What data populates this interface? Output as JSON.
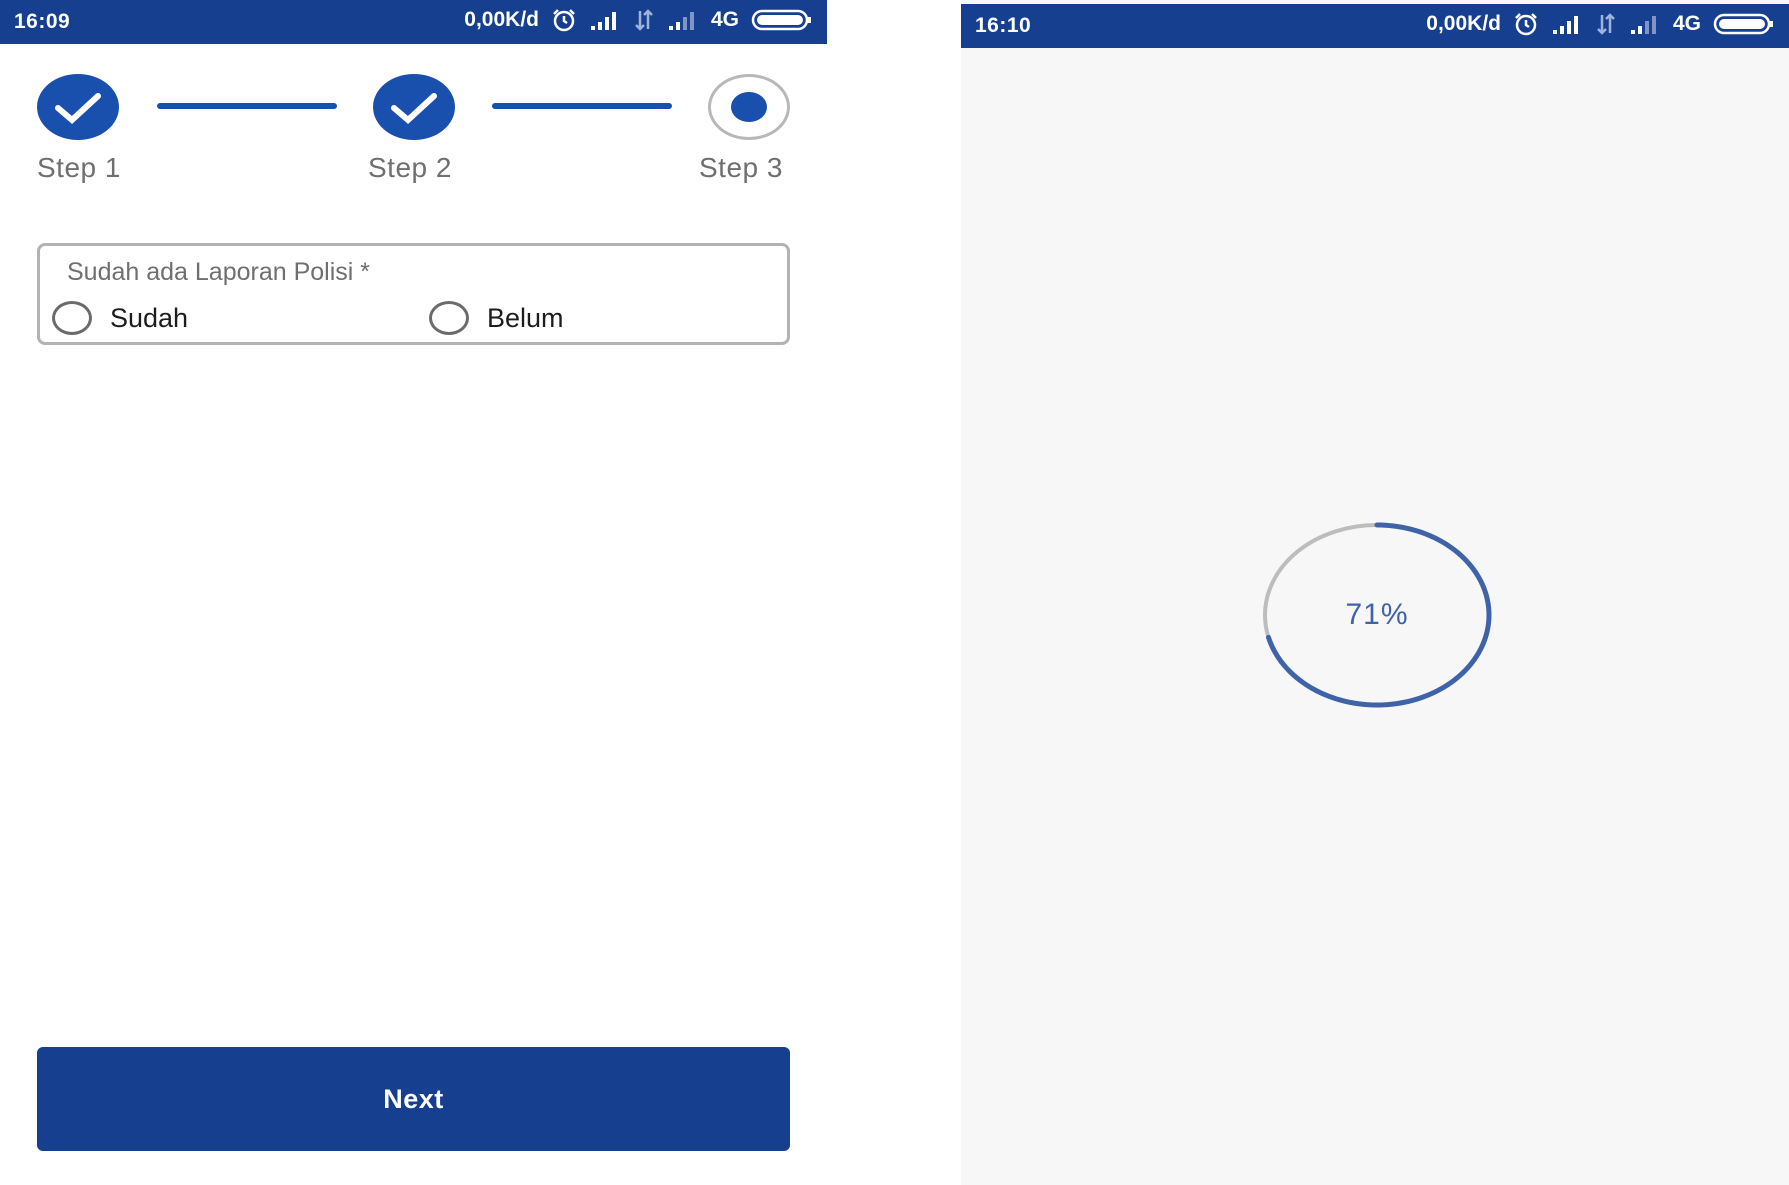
{
  "left_screen": {
    "status_bar": {
      "time": "16:09",
      "network_speed": "0,00K/d",
      "network_type": "4G",
      "icons": [
        "alarm-icon",
        "signal-icon",
        "data-transfer-icon",
        "signal-weak-icon",
        "battery-icon"
      ]
    },
    "stepper": {
      "steps": [
        {
          "label": "Step 1",
          "state": "done",
          "icon": "check-icon"
        },
        {
          "label": "Step 2",
          "state": "done",
          "icon": "check-icon"
        },
        {
          "label": "Step 3",
          "state": "current",
          "icon": "dot-icon"
        }
      ]
    },
    "report_question": {
      "label": "Sudah ada Laporan Polisi *",
      "options": [
        {
          "label": "Sudah",
          "selected": false
        },
        {
          "label": "Belum",
          "selected": false
        }
      ]
    },
    "next_button": {
      "label": "Next"
    }
  },
  "right_screen": {
    "status_bar": {
      "time": "16:10",
      "network_speed": "0,00K/d",
      "network_type": "4G",
      "icons": [
        "alarm-icon",
        "signal-icon",
        "data-transfer-icon",
        "signal-weak-icon",
        "battery-icon"
      ]
    },
    "progress": {
      "value_text": "71%",
      "fraction": 0.71
    }
  },
  "colors": {
    "primary": "#16408f",
    "accent": "#1a50ad",
    "progress_arc": "#3f63a8",
    "progress_track": "#bdbdbd",
    "label_gray": "#6f6f6f"
  }
}
